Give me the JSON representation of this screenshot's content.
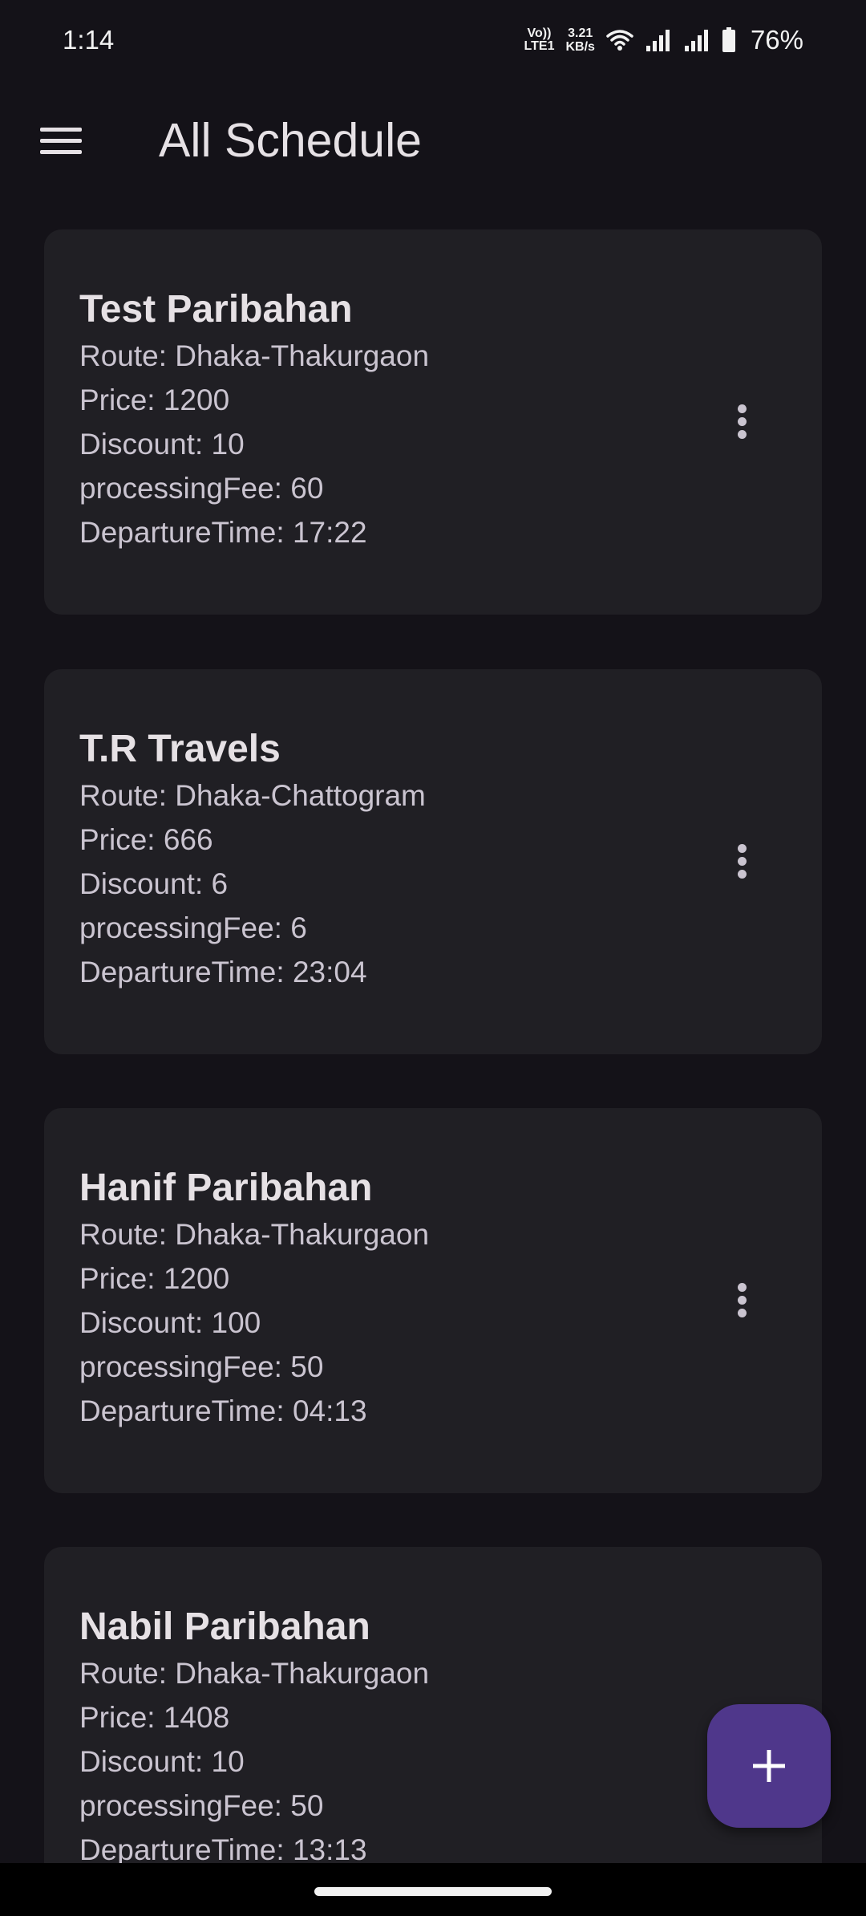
{
  "status_bar": {
    "time": "1:14",
    "network_tag_top": "Vo))",
    "network_tag_bottom": "LTE1",
    "speed_value": "3.21",
    "speed_unit": "KB/s",
    "battery_percent": "76%",
    "icons": [
      "wifi-icon",
      "signal-icon",
      "signal-icon",
      "battery-icon"
    ]
  },
  "app_bar": {
    "menu_icon": "menu-icon",
    "title": "All Schedule"
  },
  "schedules": [
    {
      "name": "Test Paribahan",
      "route": "Route: Dhaka-Thakurgaon",
      "price": "Price: 1200",
      "discount": "Discount: 10",
      "processing_fee": "processingFee: 60",
      "departure": "DepartureTime: 17:22"
    },
    {
      "name": "T.R Travels",
      "route": "Route: Dhaka-Chattogram",
      "price": "Price: 666",
      "discount": "Discount: 6",
      "processing_fee": "processingFee: 6",
      "departure": "DepartureTime: 23:04"
    },
    {
      "name": "Hanif Paribahan",
      "route": "Route: Dhaka-Thakurgaon",
      "price": "Price: 1200",
      "discount": "Discount: 100",
      "processing_fee": "processingFee: 50",
      "departure": "DepartureTime: 04:13"
    },
    {
      "name": "Nabil Paribahan",
      "route": "Route: Dhaka-Thakurgaon",
      "price": "Price: 1408",
      "discount": "Discount: 10",
      "processing_fee": "processingFee: 50",
      "departure": "DepartureTime: 13:13"
    }
  ],
  "fab": {
    "icon": "plus-icon",
    "color": "#4f378b"
  },
  "colors": {
    "background": "#141218",
    "card": "#201f24",
    "title_text": "#e6e1e5",
    "body_text": "#cac4d0"
  }
}
